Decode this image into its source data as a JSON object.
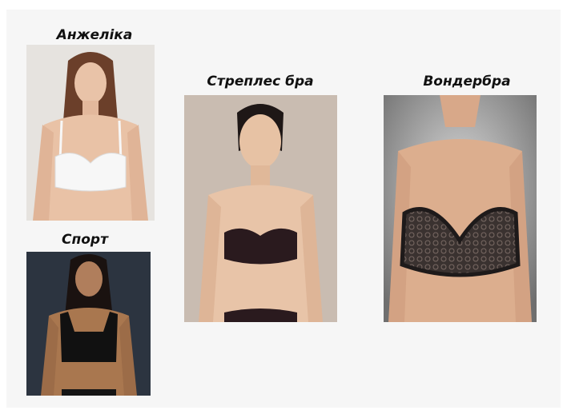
{
  "slide": {
    "items": [
      {
        "label": "Анжеліка",
        "photo": "woman-white-balconette-bra-photo",
        "background": "#e6e3df",
        "bra_color": "#f7f7f7"
      },
      {
        "label": "Спорт",
        "photo": "woman-black-sports-bra-photo",
        "background": "#2c3440",
        "bra_color": "#111111"
      },
      {
        "label": "Стреплес бра",
        "photo": "woman-black-strapless-bra-photo",
        "background": "#c9bcb1",
        "bra_color": "#2a1a1e"
      },
      {
        "label": "Вондербра",
        "photo": "woman-lace-wonderbra-photo",
        "background": "#7c7c7c",
        "bra_color": "#1e1a1a"
      }
    ]
  }
}
